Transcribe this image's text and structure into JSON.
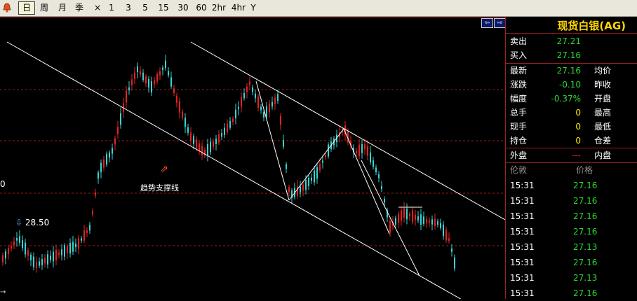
{
  "toolbar": {
    "icon": "alarm-bell-icon",
    "periods": [
      "日",
      "周",
      "月",
      "季",
      "×",
      "1",
      "3",
      "5",
      "15",
      "30",
      "60",
      "2hr",
      "4hr",
      "Y"
    ],
    "active_period": "日"
  },
  "chart": {
    "annotation_label": "趋势支撑线",
    "price_marker_label": "28.50",
    "left_axis_label": "0",
    "bottom_left_glyph": "→"
  },
  "panel": {
    "title": "现货白银(AG)",
    "quote_rows": [
      {
        "label": "卖出",
        "value": "27.21",
        "value_color": "green"
      },
      {
        "label": "买入",
        "value": "27.16",
        "value_color": "green"
      }
    ],
    "stat_rows": [
      {
        "label": "最新",
        "value": "27.16",
        "value_color": "green",
        "label2": "均价"
      },
      {
        "label": "涨跌",
        "value": "-0.10",
        "value_color": "green",
        "label2": "昨收"
      },
      {
        "label": "幅度",
        "value": "-0.37%",
        "value_color": "green",
        "label2": "开盘"
      },
      {
        "label": "总手",
        "value": "0",
        "value_color": "yellow",
        "label2": "最高"
      },
      {
        "label": "现手",
        "value": "0",
        "value_color": "yellow",
        "label2": "最低"
      },
      {
        "label": "持仓",
        "value": "0",
        "value_color": "yellow",
        "label2": "仓差"
      }
    ],
    "outer_row": {
      "label": "外盘",
      "value": "---",
      "value_color": "red",
      "label2": "内盘"
    },
    "ticks_header": {
      "time": "伦敦",
      "price": "价格"
    },
    "ticks": [
      {
        "time": "15:31",
        "price": "27.16"
      },
      {
        "time": "15:31",
        "price": "27.16"
      },
      {
        "time": "15:31",
        "price": "27.16"
      },
      {
        "time": "15:31",
        "price": "27.16"
      },
      {
        "time": "15:31",
        "price": "27.13"
      },
      {
        "time": "15:31",
        "price": "27.16"
      },
      {
        "time": "15:31",
        "price": "27.13"
      },
      {
        "time": "15:31",
        "price": "27.16"
      }
    ]
  },
  "colors": {
    "up_candle": "#e82020",
    "down_candle": "#39d2d2",
    "grid": "#a01818",
    "trendline": "#ffffff",
    "accent_title": "#ffd700",
    "green_value": "#31d531"
  }
}
